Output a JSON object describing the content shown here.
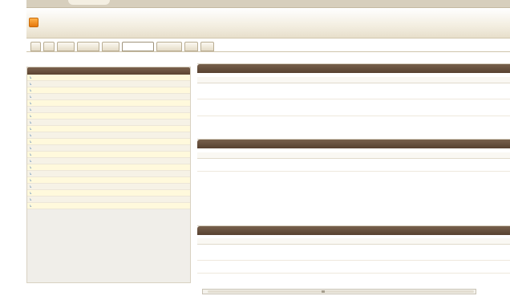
{
  "app": {
    "logo_glyph": "",
    "title": ""
  },
  "tabs": [
    {
      "label": "",
      "active": false
    },
    {
      "label": "",
      "active": false
    },
    {
      "label": "",
      "active": false
    },
    {
      "label": "",
      "active": false
    },
    {
      "label": "",
      "active": false
    },
    {
      "label": "",
      "active": true
    },
    {
      "label": "",
      "active": false
    },
    {
      "label": "",
      "active": false
    },
    {
      "label": "",
      "active": false
    }
  ],
  "left_panel": {
    "title": "",
    "rows": [
      {
        "cells": [
          "",
          "",
          "",
          "",
          "",
          ""
        ]
      },
      {
        "cells": [
          "",
          "",
          "",
          "",
          "",
          ""
        ]
      },
      {
        "cells": [
          "",
          "",
          "",
          "",
          "",
          ""
        ]
      },
      {
        "cells": [
          "",
          "",
          "",
          "",
          "",
          ""
        ]
      },
      {
        "cells": [
          "",
          "",
          "",
          "",
          "",
          ""
        ]
      },
      {
        "cells": [
          "",
          "",
          "",
          "",
          "",
          ""
        ]
      },
      {
        "cells": [
          "",
          "",
          "",
          "",
          "",
          ""
        ]
      },
      {
        "cells": [
          "",
          "",
          "",
          "",
          "",
          ""
        ]
      },
      {
        "cells": [
          "",
          "",
          "",
          "",
          "",
          ""
        ]
      },
      {
        "cells": [
          "",
          "",
          "",
          "",
          "",
          ""
        ]
      },
      {
        "cells": [
          "",
          "",
          "",
          "",
          "",
          ""
        ]
      },
      {
        "cells": [
          "",
          "",
          "",
          "",
          "",
          ""
        ]
      },
      {
        "cells": [
          "",
          "",
          "",
          "",
          "",
          ""
        ]
      },
      {
        "cells": [
          "",
          "",
          "",
          "",
          "",
          ""
        ]
      },
      {
        "cells": [
          "",
          "",
          "",
          "",
          "",
          ""
        ]
      },
      {
        "cells": [
          "",
          "",
          "",
          "",
          "",
          ""
        ]
      },
      {
        "cells": [
          "",
          "",
          "",
          "",
          "",
          ""
        ]
      },
      {
        "cells": [
          "",
          "",
          "",
          "",
          "",
          ""
        ]
      },
      {
        "cells": [
          "",
          "",
          "",
          "",
          "",
          ""
        ]
      },
      {
        "cells": [
          "",
          "",
          "",
          "",
          "",
          ""
        ]
      },
      {
        "cells": [
          "",
          "",
          "",
          "",
          "",
          ""
        ]
      }
    ]
  },
  "panel_costs": {
    "title": "",
    "headers": [
      "",
      "",
      "",
      "",
      "",
      "",
      "",
      ""
    ],
    "sum": "",
    "groups": [
      "",
      ""
    ]
  },
  "panel_budget": {
    "title": "",
    "headers": [
      "",
      "",
      "",
      "",
      ""
    ],
    "sum": "",
    "group": "",
    "row": "",
    "add_link": ""
  },
  "panel_project": {
    "title": "",
    "headers": [
      "",
      "",
      "",
      "",
      "",
      "",
      "",
      ""
    ],
    "sum": "",
    "groups": [
      "",
      ""
    ]
  },
  "colors": {
    "header_bar": "#5c4432",
    "row_odd": "#fff9dc",
    "group_text": "#8a2f1e"
  }
}
